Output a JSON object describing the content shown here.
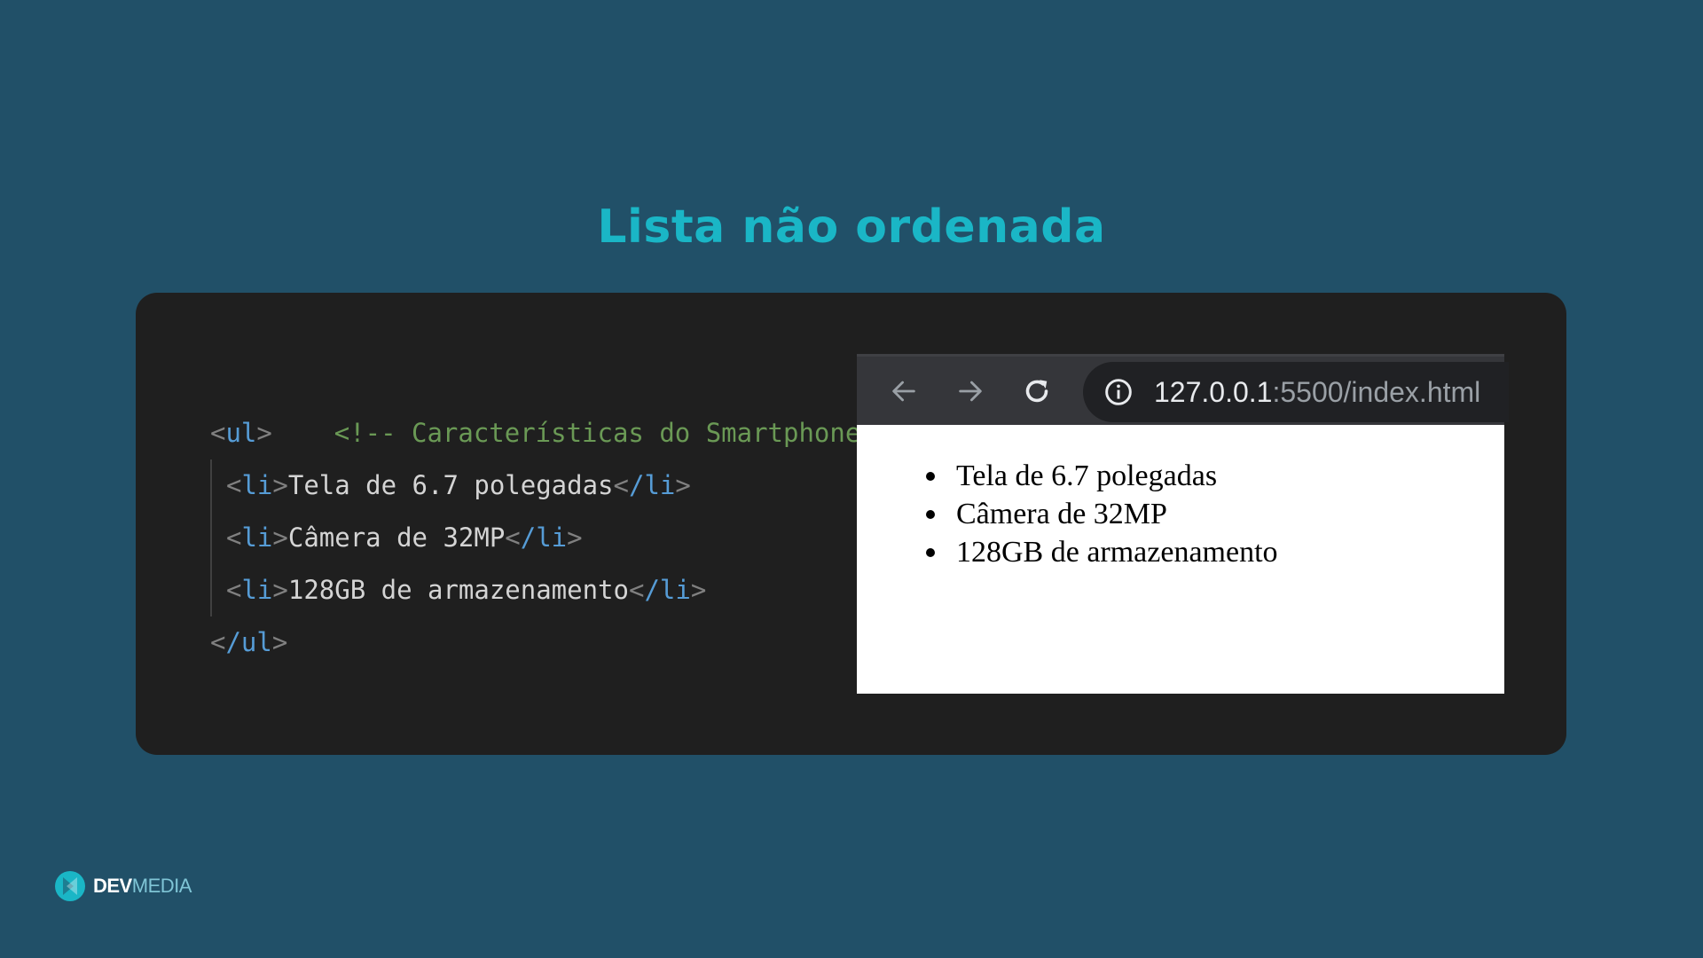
{
  "slide": {
    "title": "Lista não ordenada"
  },
  "code": {
    "comment": "<!-- Características do Smartphone  -->",
    "ul_open": "ul",
    "ul_close": "/ul",
    "items": [
      {
        "tag_open": "li",
        "text": "Tela de 6.7 polegadas",
        "tag_close": "/li"
      },
      {
        "tag_open": "li",
        "text": "Câmera de 32MP",
        "tag_close": "/li"
      },
      {
        "tag_open": "li",
        "text": "128GB de armazenamento",
        "tag_close": "/li"
      }
    ]
  },
  "browser": {
    "url_host": "127.0.0.1",
    "url_rest": ":5500/index.html",
    "icons": [
      "back-arrow-icon",
      "forward-arrow-icon",
      "reload-icon",
      "info-icon"
    ],
    "list_items": [
      "Tela de 6.7 polegadas",
      "Câmera de 32MP",
      "128GB de armazenamento"
    ]
  },
  "logo": {
    "dev": "DEV",
    "media": "MEDIA"
  },
  "colors": {
    "background": "#215068",
    "title": "#1ab6c6",
    "card": "#1f1f1f",
    "comment": "#6a9955",
    "tag": "#569cd6",
    "bracket": "#808080"
  }
}
